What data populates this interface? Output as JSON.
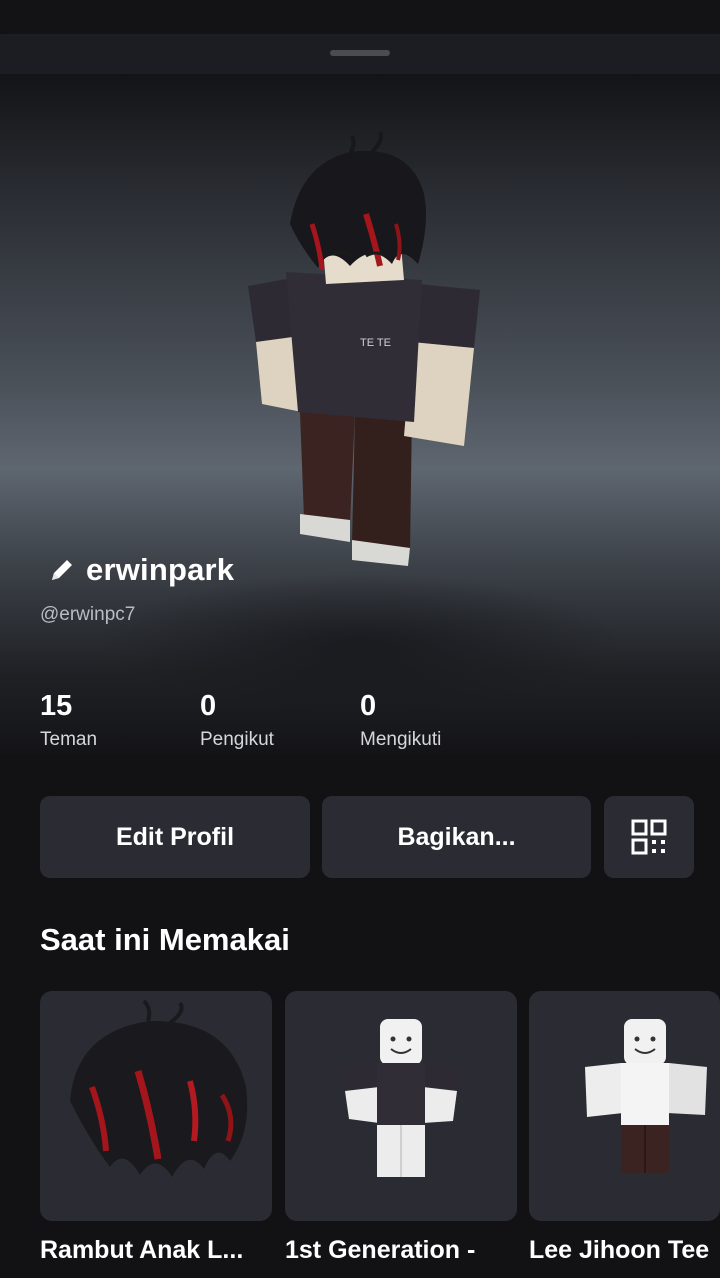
{
  "profile": {
    "display_name": "erwinpark",
    "username": "@erwinpc7"
  },
  "stats": [
    {
      "value": "15",
      "label": "Teman"
    },
    {
      "value": "0",
      "label": "Pengikut"
    },
    {
      "value": "0",
      "label": "Mengikuti"
    }
  ],
  "actions": {
    "edit_label": "Edit Profil",
    "share_label": "Bagikan..."
  },
  "wearing": {
    "title": "Saat ini Memakai",
    "items": [
      {
        "name": "Rambut Anak L...",
        "icon": "hair-accessory-icon"
      },
      {
        "name": "1st Generation -",
        "icon": "shirt-avatar-icon"
      },
      {
        "name": "Lee Jihoon Tee",
        "icon": "tshirt-avatar-icon"
      }
    ]
  },
  "avatar_shirt_text": "TE TE",
  "icons": {
    "edit": "pencil-icon",
    "qr": "qr-code-icon"
  },
  "colors": {
    "background": "#121215",
    "card": "#2b2c33",
    "text_secondary": "#b9bcc2"
  }
}
